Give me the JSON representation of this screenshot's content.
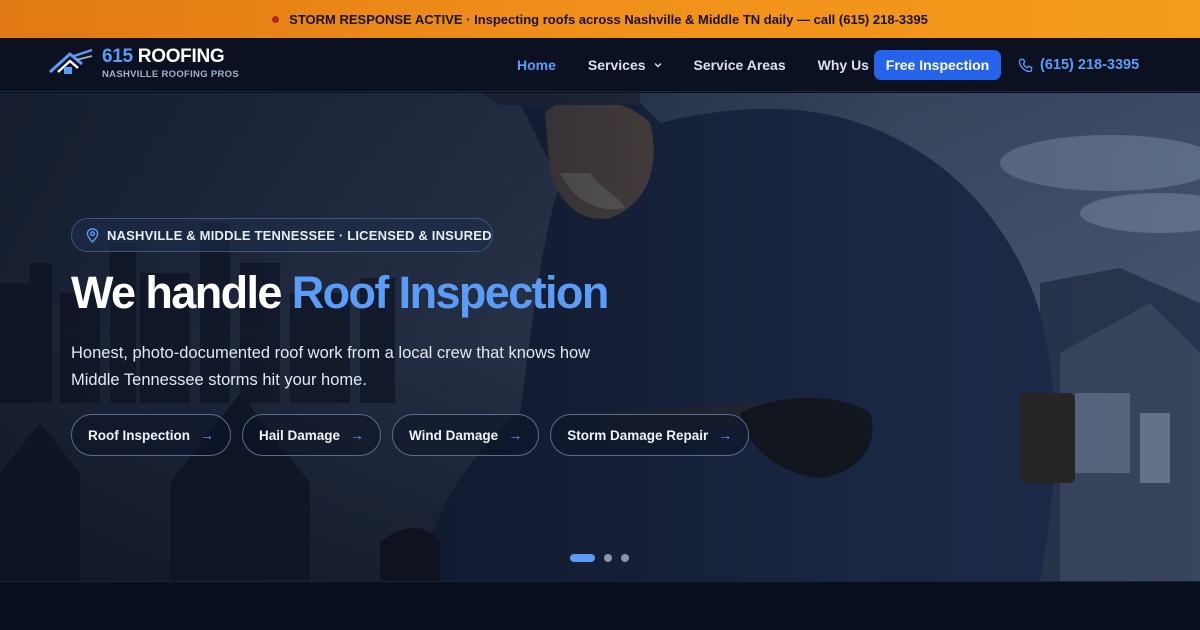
{
  "alert": {
    "text": "STORM RESPONSE ACTIVE · Inspecting roofs across Nashville & Middle TN daily — call (615) 218-3395"
  },
  "brand": {
    "number": "615",
    "name": " ROOFING",
    "tagline": "NASHVILLE ROOFING PROS"
  },
  "nav": {
    "items": [
      {
        "label": "Home",
        "active": true
      },
      {
        "label": "Services",
        "dropdown": true
      },
      {
        "label": "Service Areas"
      },
      {
        "label": "Why Us"
      }
    ],
    "cta_label": "Free Inspection",
    "phone": "(615) 218-3395"
  },
  "hero": {
    "badge": "NASHVILLE & MIDDLE TENNESSEE · LICENSED & INSURED",
    "headline_prefix": "We handle ",
    "headline_highlight": "Roof Inspection",
    "lede": "Honest, photo-documented roof work from a local crew that knows how Middle Tennessee storms hit your home.",
    "chips": [
      {
        "label": "Roof Inspection",
        "icon": "arrow-right-icon"
      },
      {
        "label": "Hail Damage",
        "icon": "arrow-right-icon"
      },
      {
        "label": "Wind Damage",
        "icon": "arrow-right-icon"
      },
      {
        "label": "Storm Damage Repair",
        "icon": "arrow-right-icon"
      }
    ],
    "carousel": {
      "slides": 3,
      "active": 1
    }
  },
  "colors": {
    "accent": "#5b9cf6",
    "cta": "#2563eb",
    "alert_bar": "#f0901a",
    "background": "#0a1020"
  }
}
